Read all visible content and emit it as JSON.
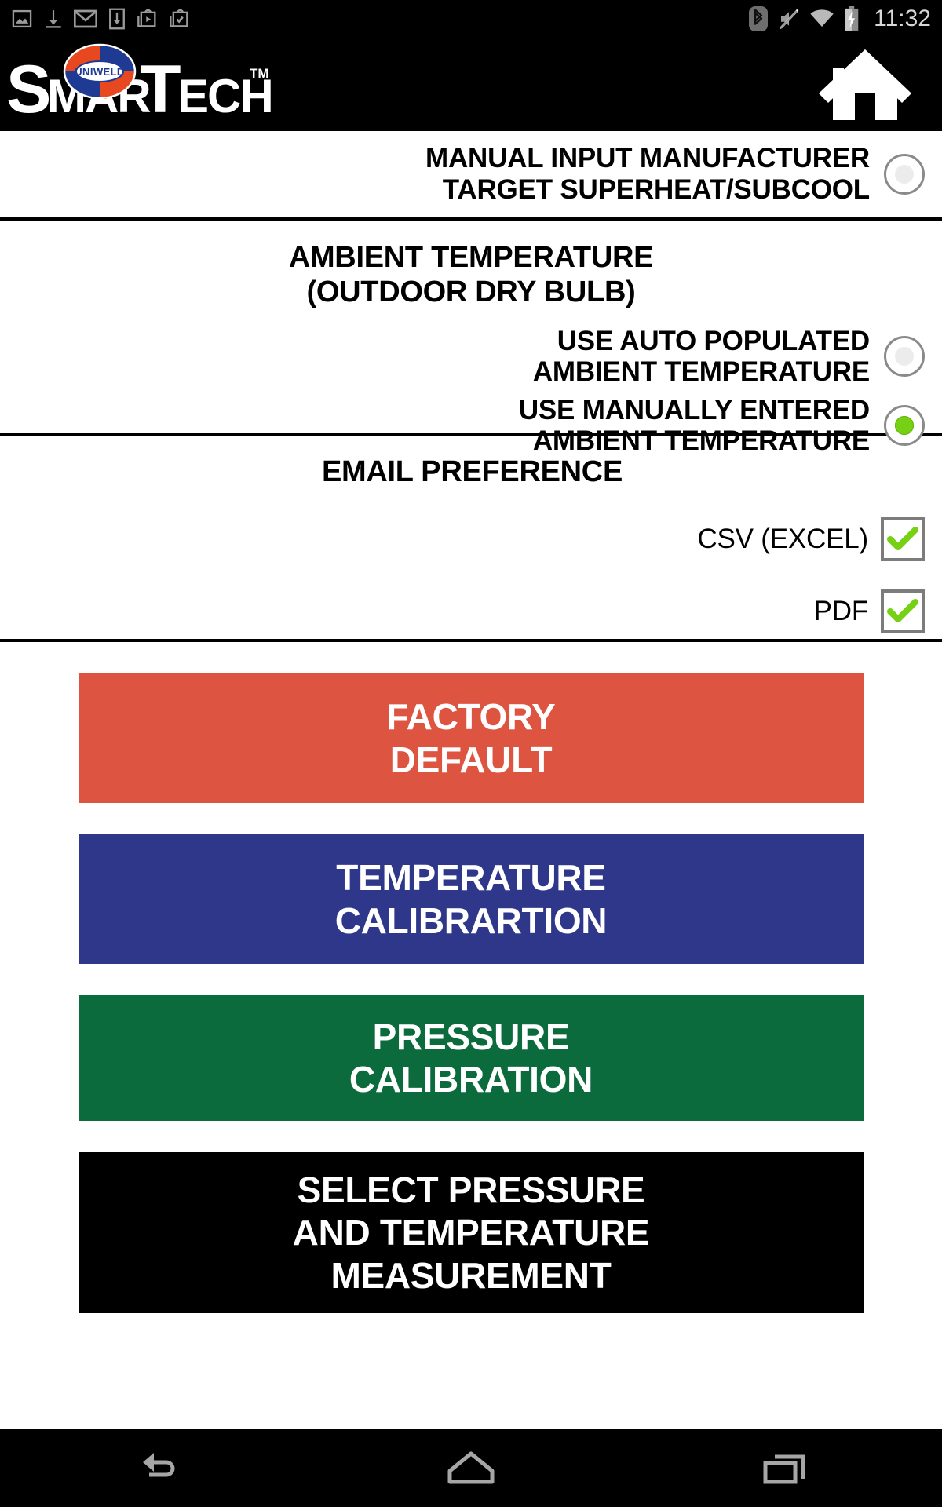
{
  "status_bar": {
    "time": "11:32",
    "left_icons": [
      "screenshot-icon",
      "download-icon",
      "gmail-icon",
      "phone-download-icon",
      "play-store-download-icon",
      "play-store-installed-icon"
    ],
    "right_icons": [
      "bluetooth-icon",
      "volume-mute-icon",
      "wifi-icon",
      "battery-charging-icon"
    ]
  },
  "app_header": {
    "brand_badge": "UNIWELD",
    "brand_name": "SMARTECH",
    "trademark": "TM",
    "home_icon": "home-icon"
  },
  "sections": {
    "manual_input": {
      "label_line1": "MANUAL INPUT MANUFACTURER",
      "label_line2": "TARGET SUPERHEAT/SUBCOOL",
      "selected": false
    },
    "ambient": {
      "title_line1": "AMBIENT TEMPERATURE",
      "title_line2": "(OUTDOOR DRY BULB)",
      "options": [
        {
          "label_line1": "USE AUTO POPULATED",
          "label_line2": "AMBIENT TEMPERATURE",
          "selected": false
        },
        {
          "label_line1": "USE MANUALLY ENTERED",
          "label_line2": "AMBIENT TEMPERATURE",
          "selected": true
        }
      ]
    },
    "email_preference": {
      "title": "EMAIL PREFERENCE",
      "options": [
        {
          "label": "CSV (EXCEL)",
          "checked": true
        },
        {
          "label": "PDF",
          "checked": true
        }
      ]
    }
  },
  "buttons": [
    {
      "line1": "FACTORY",
      "line2": "DEFAULT",
      "line3": "",
      "bg": "#dd5440"
    },
    {
      "line1": "TEMPERATURE",
      "line2": "CALIBRARTION",
      "line3": "",
      "bg": "#2e3789"
    },
    {
      "line1": "PRESSURE",
      "line2": "CALIBRATION",
      "line3": "",
      "bg": "#0b6b3c"
    },
    {
      "line1": "SELECT PRESSURE",
      "line2": "AND TEMPERATURE",
      "line3": "MEASUREMENT",
      "bg": "#000000"
    }
  ],
  "nav_bar": {
    "back_label": "back-icon",
    "home_label": "home-icon",
    "recents_label": "recents-icon"
  },
  "colors": {
    "accent_green": "#76d013",
    "check_green": "#76d013",
    "factory_red": "#dd5440",
    "temp_blue": "#2e3789",
    "pressure_green": "#0b6b3c",
    "black": "#000000"
  }
}
